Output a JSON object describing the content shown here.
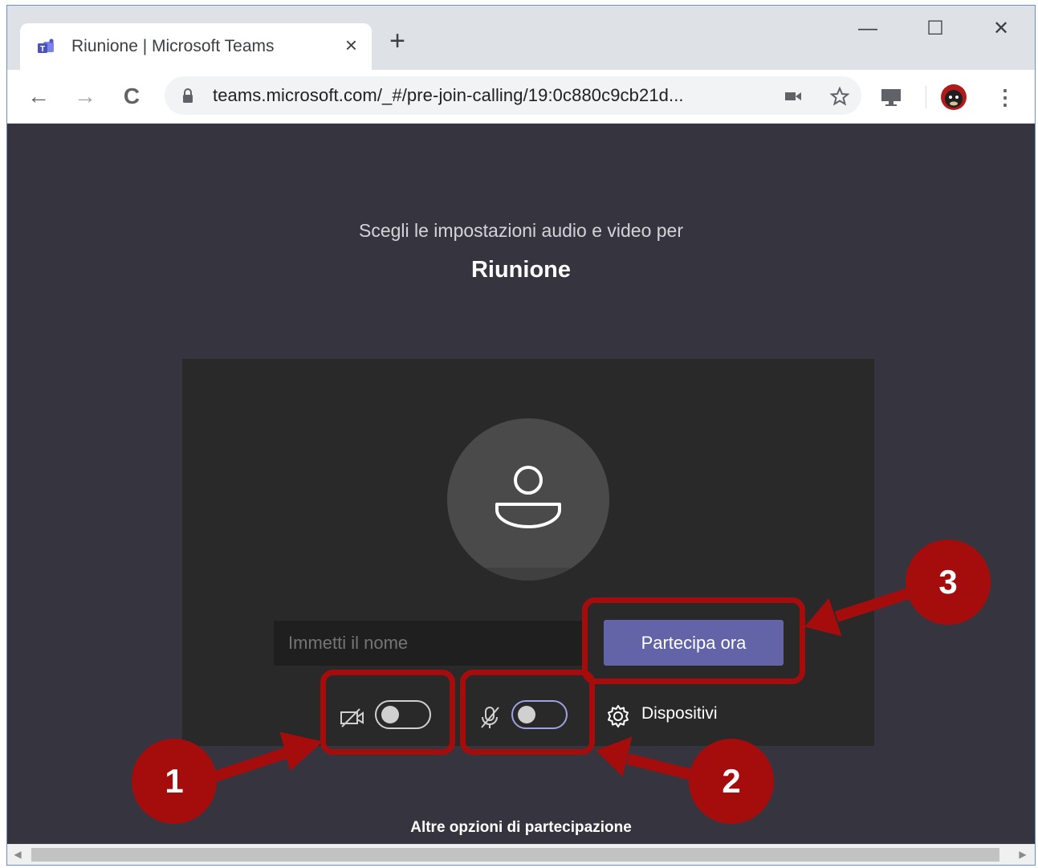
{
  "browser": {
    "tab_title": "Riunione | Microsoft Teams",
    "tab_close": "×",
    "new_tab": "+",
    "window_controls": {
      "minimize": "—",
      "maximize": "☐",
      "close": "✕"
    },
    "nav": {
      "back": "←",
      "forward": "→",
      "reload": "C"
    },
    "url": "teams.microsoft.com/_#/pre-join-calling/19:0c880c9cb21d...",
    "omnibox_icons": [
      "video-camera-icon",
      "star-icon"
    ],
    "toolbar_icons": [
      "cast-icon",
      "profile-avatar",
      "kebab-menu-icon"
    ]
  },
  "prejoin": {
    "subtitle": "Scegli le impostazioni audio e video per",
    "meeting_title": "Riunione",
    "name_placeholder": "Immetti il nome",
    "join_label": "Partecipa ora",
    "devices_label": "Dispositivi",
    "more_options": "Altre opzioni di partecipazione",
    "camera_on": false,
    "mic_on": false
  },
  "annotations": {
    "badge_1": "1",
    "badge_2": "2",
    "badge_3": "3",
    "color": "#a50d0d"
  },
  "colors": {
    "page_bg": "#36353f",
    "card_bg": "#292929",
    "accent": "#6264a7"
  }
}
